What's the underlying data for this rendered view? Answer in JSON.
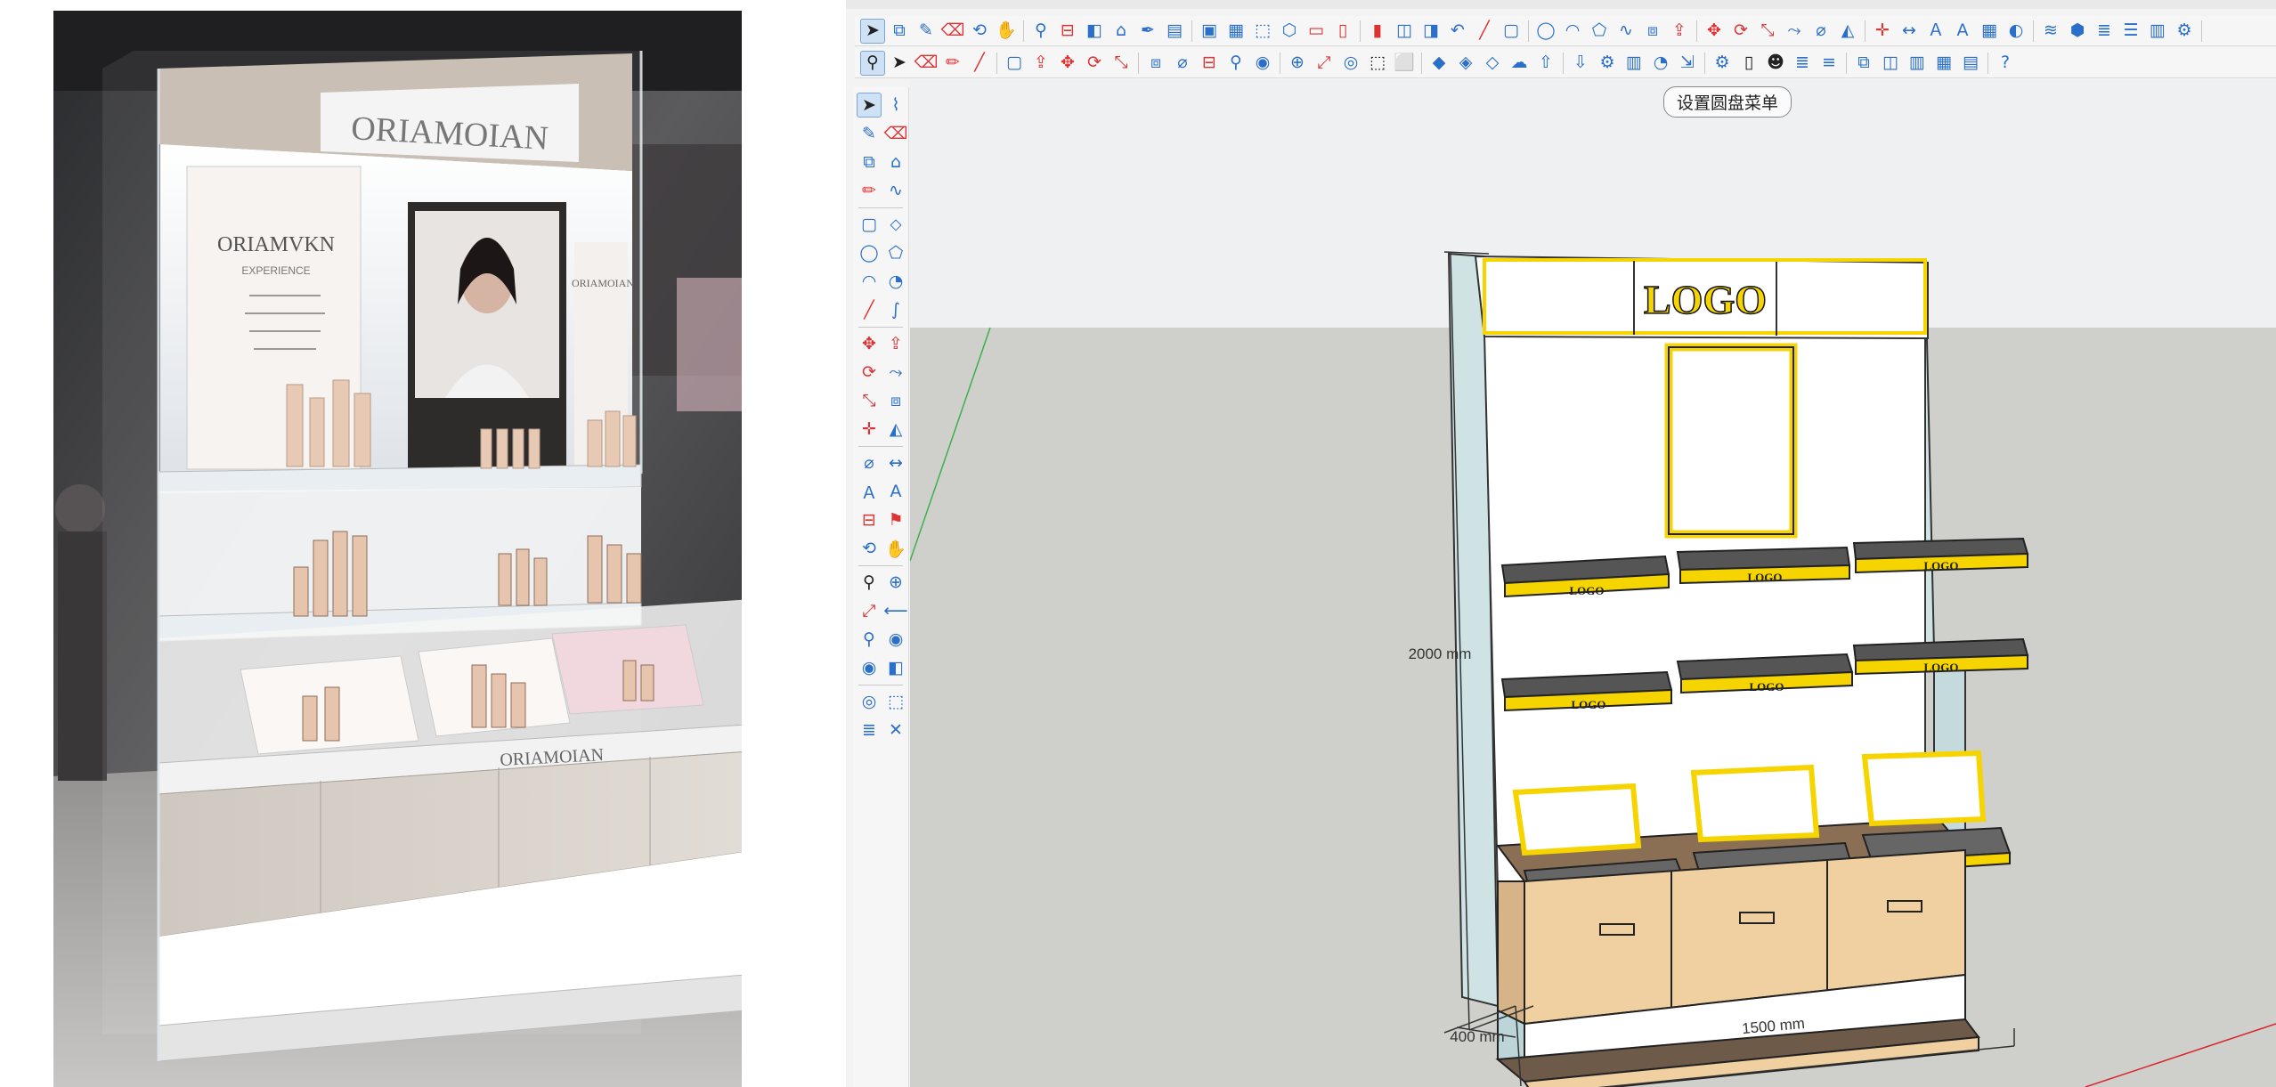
{
  "photo": {
    "brand_header": "ORIAMOIAN",
    "brand_counter": "ORIAMOIAN",
    "panel_left_title": "ORIAMVKN",
    "panel_left_sub": "EXPERIENCE",
    "panel_right_title": "ORIAMOIAN"
  },
  "sketchup": {
    "tooltip": "设置圆盘菜单",
    "logo_text": "LOGO",
    "dim_height": "2000 mm",
    "dim_depth": "400 mm",
    "dim_width": "1500 mm"
  },
  "colors": {
    "accent_yellow": "#f5d400",
    "cabinet_wood": "#f0cfa0",
    "sky": "#eef0f1",
    "ground": "#cfcfcc",
    "toolbar_bg": "#f6f6f6"
  },
  "toolbar_top_icons": [
    "select-icon",
    "component-icon",
    "paint-icon",
    "eraser-icon",
    "orbit-icon",
    "pan-icon",
    "walk-icon",
    "section-icon",
    "material-icon",
    "tag-icon",
    "eyedropper-icon",
    "folder-icon",
    "save-icon",
    "print-icon",
    "views-icon",
    "iso-icon",
    "top-view-icon",
    "front-view-icon",
    "right-view-icon",
    "back-view-icon",
    "left-view-icon",
    "undo-icon",
    "line-icon",
    "rectangle-icon",
    "circle-icon",
    "arc-icon",
    "polygon-icon",
    "freehand-icon",
    "offset-icon",
    "pushpull-icon",
    "move-icon",
    "rotate-icon",
    "scale-icon",
    "followme-icon",
    "tape-icon",
    "protractor-icon",
    "axes-icon",
    "dimension-icon",
    "text-icon",
    "3dtext-icon",
    "sandbox-icon",
    "shadow-icon",
    "fog-icon",
    "styles-icon",
    "layers-icon",
    "outliner-icon",
    "scenes-icon",
    "settings-icon"
  ],
  "toolbar_second_icons": [
    "zoom-icon",
    "select-icon",
    "eraser-icon",
    "pencil-icon",
    "line-icon",
    "rectangle-icon",
    "pushpull-icon",
    "move-icon",
    "rotate-icon",
    "scale-icon",
    "offset-icon",
    "tape-icon",
    "section-icon",
    "walk-icon",
    "lookaround-icon",
    "zoom-window-icon",
    "zoom-extents-icon",
    "xray-icon",
    "wireframe-icon",
    "hidden-line-icon",
    "shaded-icon",
    "textured-icon",
    "monochrome-icon",
    "cloud-icon",
    "upload-icon",
    "download-icon",
    "gear-icon",
    "ruler-icon",
    "clock-icon",
    "export-icon",
    "settings-icon",
    "page-icon",
    "person-icon",
    "layers-icon",
    "stack-icon",
    "component-icon",
    "panel-icon",
    "columns-icon",
    "table-icon",
    "chart-icon",
    "help-icon"
  ],
  "left_tool_icons": [
    "select-icon",
    "lasso-icon",
    "paint-icon",
    "eraser-icon",
    "component-icon",
    "tag-icon",
    "pencil-icon",
    "freehand-icon",
    "rectangle-icon",
    "rotated-rect-icon",
    "circle-icon",
    "polygon-icon",
    "arc-icon",
    "pie-icon",
    "line-icon",
    "spline-icon",
    "move-icon",
    "pushpull-icon",
    "rotate-icon",
    "followme-icon",
    "scale-icon",
    "offset-icon",
    "axes-icon",
    "protractor-icon",
    "tape-icon",
    "dimension-icon",
    "text-icon",
    "3dtext-icon",
    "section-icon",
    "position-camera-icon",
    "orbit-icon",
    "pan-icon",
    "zoom-icon",
    "zoom-window-icon",
    "zoom-extents-icon",
    "previous-icon",
    "walk-icon",
    "lookaround-icon",
    "eye-icon",
    "section-fill-icon",
    "xray-icon",
    "back-edges-icon",
    "layers-icon",
    "hide-icon"
  ]
}
